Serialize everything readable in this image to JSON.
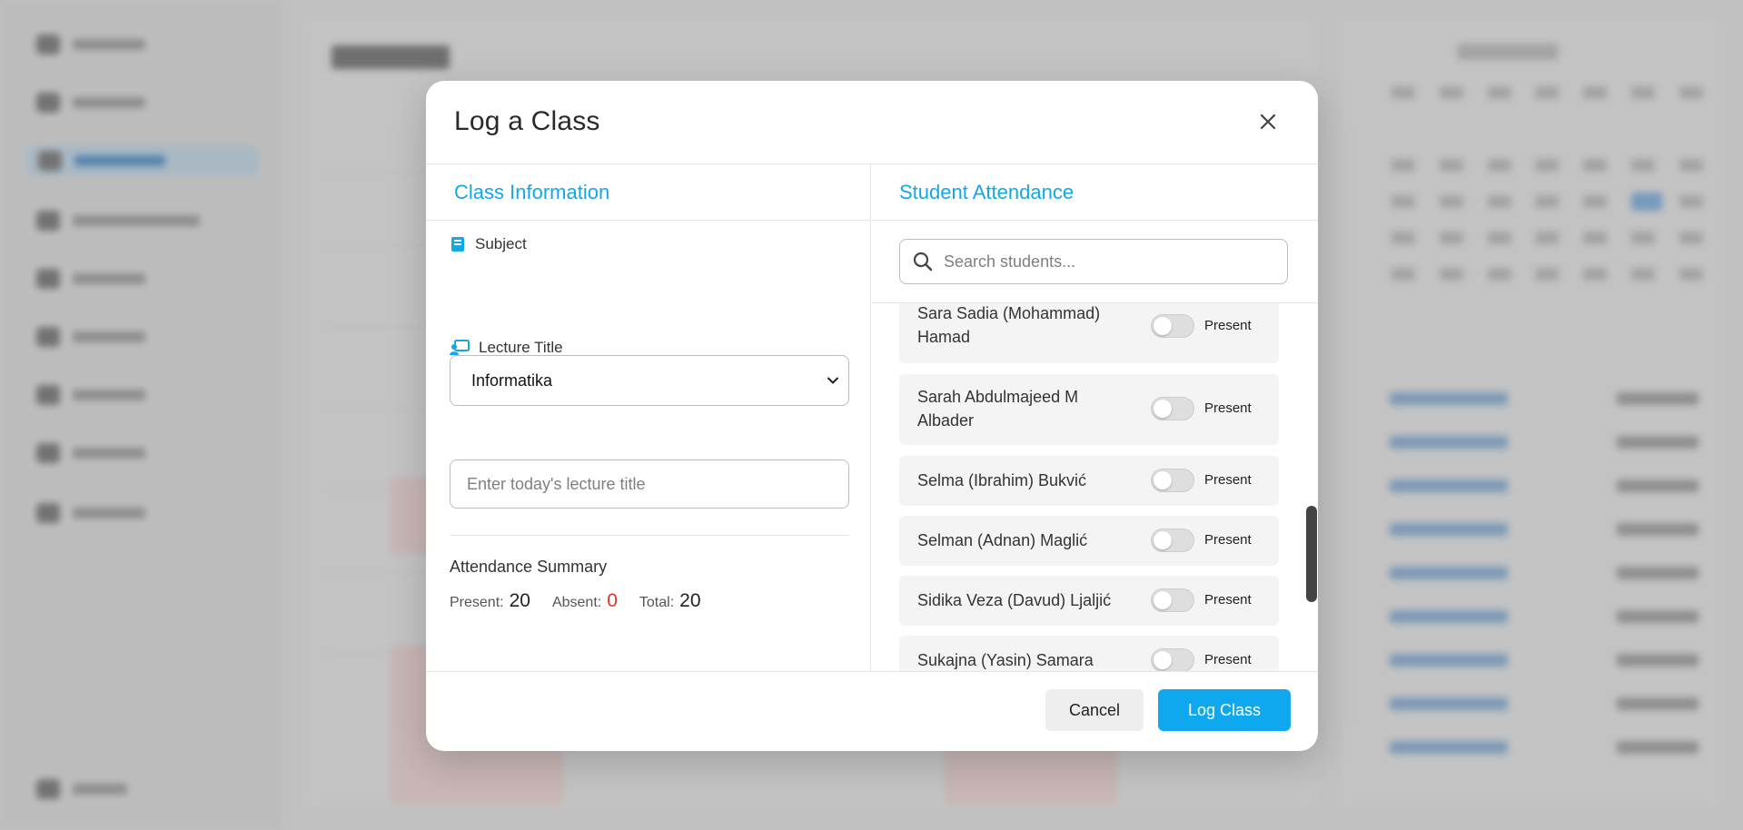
{
  "modal": {
    "title": "Log a Class",
    "close_icon": "close-icon"
  },
  "class_info": {
    "heading": "Class Information",
    "subject_label": "Subject",
    "subject_icon": "book-icon",
    "subject_value": "Informatika",
    "lecture_label": "Lecture Title",
    "lecture_icon": "presentation-icon",
    "lecture_placeholder": "Enter today's lecture title"
  },
  "summary": {
    "title": "Attendance Summary",
    "present_label": "Present:",
    "present_value": "20",
    "absent_label": "Absent:",
    "absent_value": "0",
    "total_label": "Total:",
    "total_value": "20"
  },
  "attendance": {
    "heading": "Student Attendance",
    "search_placeholder": "Search students...",
    "students": [
      {
        "name": "Sara Sadia (Mohammad) Hamad",
        "status": "Present"
      },
      {
        "name": "Sarah Abdulmajeed M Albader",
        "status": "Present"
      },
      {
        "name": "Selma (Ibrahim) Bukvić",
        "status": "Present"
      },
      {
        "name": "Selman (Adnan) Maglić",
        "status": "Present"
      },
      {
        "name": "Sidika Veza (Davud) Ljaljić",
        "status": "Present"
      },
      {
        "name": "Sukajna (Yasin) Samara",
        "status": "Present"
      }
    ]
  },
  "footer": {
    "cancel_label": "Cancel",
    "submit_label": "Log Class"
  },
  "colors": {
    "accent": "#14a7e6",
    "primary_button": "#0fa8ef",
    "absent": "#e0352b"
  }
}
